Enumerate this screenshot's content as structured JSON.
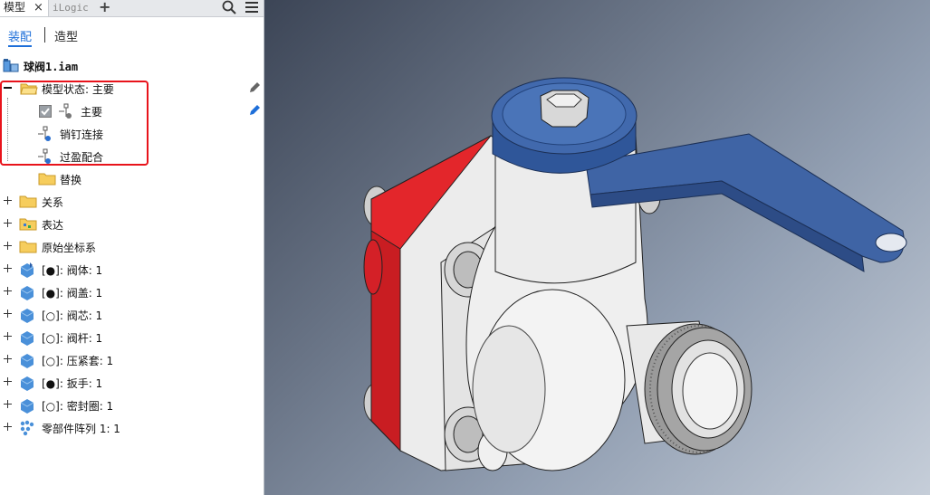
{
  "panel": {
    "tabs": [
      {
        "label": "模型",
        "close": "×"
      },
      {
        "label": "iLogic"
      },
      {
        "label": "+"
      }
    ],
    "subtabs": {
      "assembly": "装配",
      "modeling": "造型"
    },
    "root": "球阀1.iam",
    "model_state": {
      "label": "模型状态: 主要",
      "children": [
        {
          "label": "主要"
        },
        {
          "label": "销钉连接"
        },
        {
          "label": "过盈配合"
        },
        {
          "label": "替换"
        }
      ]
    },
    "tree": [
      {
        "label": "关系"
      },
      {
        "label": "表达"
      },
      {
        "label": "原始坐标系"
      },
      {
        "label": "[●]: 阀体: 1"
      },
      {
        "label": "[●]: 阀盖: 1"
      },
      {
        "label": "[○]: 阀芯: 1"
      },
      {
        "label": "[○]: 阀杆: 1"
      },
      {
        "label": "[○]: 压紧套: 1"
      },
      {
        "label": "[●]: 扳手: 1"
      },
      {
        "label": "[○]: 密封圈: 1"
      },
      {
        "label": "零部件阵列 1: 1"
      }
    ]
  },
  "colors": {
    "accent": "#1e6fd9",
    "highlight": "#e8131b",
    "handle_blue": "#3f64a5",
    "flange_red": "#e3262b"
  },
  "icons": [
    "search-icon",
    "menu-icon",
    "pencil-icon",
    "folder-icon",
    "assembly-icon",
    "part-icon",
    "checkbox-icon",
    "pattern-icon"
  ]
}
